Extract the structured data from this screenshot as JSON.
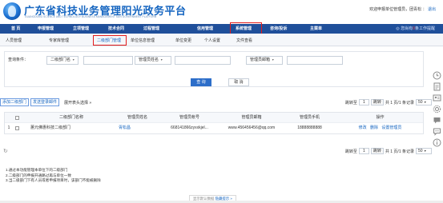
{
  "header": {
    "title": "广东省科技业务管理阳光政务平台",
    "subtitle": "GUANGDONG SCIENCE AND TECHNOLOGY BUSINESS MANAGEMENT SUN GOVERNMENT PLATFORM",
    "welcome_text": "欢迎申报单位管理员，团青松",
    "logout": "退出"
  },
  "main_nav": {
    "items": [
      "首 页",
      "申报管理",
      "立项管理",
      "技术合同",
      "过程管理",
      "信用管理",
      "系统管理",
      "咨询/投诉",
      "主菜单"
    ],
    "active_index": 6,
    "right_text": "您尚有",
    "right_count": "0",
    "right_suffix": "条工作提醒"
  },
  "sub_nav": {
    "items": [
      "人员管理",
      "专家库管理",
      "二级部门管理",
      "单位信息管理",
      "单位变更",
      "个人设置",
      "文件查看"
    ],
    "active_index": 2
  },
  "filter": {
    "label": "查询条件：",
    "dept_select": "二级部门名",
    "admin_name_select": "管理员姓名",
    "admin_email_select": "管理员邮箱",
    "search_btn": "查 询",
    "cancel_btn": "取 消"
  },
  "toolbar": {
    "add_btn": "添加二级部门",
    "send_email_btn": "发送登录邮件",
    "expand_text": "展开表头选择",
    "expand_arrow": "»",
    "goto_label": "跳转至",
    "page_value": "1",
    "goto_btn": "跳转",
    "page_info": "共 1 页/1 条记录",
    "page_size": "50"
  },
  "grid": {
    "columns": [
      "二级部门名称",
      "管理员姓名",
      "管理员帐号",
      "管理员邮箱",
      "管理员手机",
      "操作"
    ],
    "rows": [
      {
        "index": "1",
        "dept": "蕙元佛惠科技二级部门",
        "admin_name": "胥松昌",
        "account": "668141866zyxxkjel...",
        "email": "www.456456456@qq.com",
        "phone": "18888888888",
        "actions": [
          "修改",
          "删除",
          "设置管理员"
        ]
      }
    ]
  },
  "bottom_pager": {
    "refresh_icon": "↻",
    "goto_label": "跳转至",
    "page_value": "1",
    "goto_btn": "跳转",
    "page_info": "共 1 页/1 条记录",
    "page_size": "50"
  },
  "notes": [
    "1.通过本功能管理本单位下的二级部门",
    "2.二级部门的申报开通路过再与单位一致",
    "3.当二级部门下有人员或者申报项目时，该部门不能被删除"
  ],
  "tooltip": {
    "text": "显示默认数据",
    "link": "隐藏提示",
    "arrow": "»"
  },
  "colors": {
    "nav_bg": "#1f4f9a",
    "accent": "#1565c0",
    "highlight_box": "#e21b1b"
  }
}
